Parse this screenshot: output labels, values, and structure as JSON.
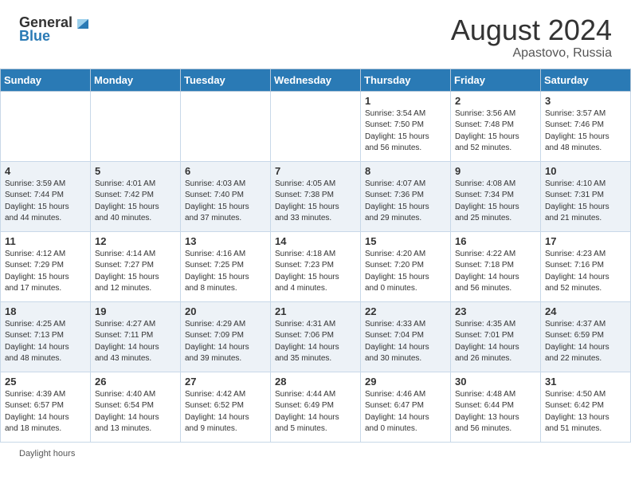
{
  "header": {
    "logo_general": "General",
    "logo_blue": "Blue",
    "month_year": "August 2024",
    "location": "Apastovo, Russia"
  },
  "footer": {
    "daylight_label": "Daylight hours"
  },
  "calendar": {
    "days_of_week": [
      "Sunday",
      "Monday",
      "Tuesday",
      "Wednesday",
      "Thursday",
      "Friday",
      "Saturday"
    ],
    "weeks": [
      [
        {
          "day": "",
          "info": ""
        },
        {
          "day": "",
          "info": ""
        },
        {
          "day": "",
          "info": ""
        },
        {
          "day": "",
          "info": ""
        },
        {
          "day": "1",
          "info": "Sunrise: 3:54 AM\nSunset: 7:50 PM\nDaylight: 15 hours\nand 56 minutes."
        },
        {
          "day": "2",
          "info": "Sunrise: 3:56 AM\nSunset: 7:48 PM\nDaylight: 15 hours\nand 52 minutes."
        },
        {
          "day": "3",
          "info": "Sunrise: 3:57 AM\nSunset: 7:46 PM\nDaylight: 15 hours\nand 48 minutes."
        }
      ],
      [
        {
          "day": "4",
          "info": "Sunrise: 3:59 AM\nSunset: 7:44 PM\nDaylight: 15 hours\nand 44 minutes."
        },
        {
          "day": "5",
          "info": "Sunrise: 4:01 AM\nSunset: 7:42 PM\nDaylight: 15 hours\nand 40 minutes."
        },
        {
          "day": "6",
          "info": "Sunrise: 4:03 AM\nSunset: 7:40 PM\nDaylight: 15 hours\nand 37 minutes."
        },
        {
          "day": "7",
          "info": "Sunrise: 4:05 AM\nSunset: 7:38 PM\nDaylight: 15 hours\nand 33 minutes."
        },
        {
          "day": "8",
          "info": "Sunrise: 4:07 AM\nSunset: 7:36 PM\nDaylight: 15 hours\nand 29 minutes."
        },
        {
          "day": "9",
          "info": "Sunrise: 4:08 AM\nSunset: 7:34 PM\nDaylight: 15 hours\nand 25 minutes."
        },
        {
          "day": "10",
          "info": "Sunrise: 4:10 AM\nSunset: 7:31 PM\nDaylight: 15 hours\nand 21 minutes."
        }
      ],
      [
        {
          "day": "11",
          "info": "Sunrise: 4:12 AM\nSunset: 7:29 PM\nDaylight: 15 hours\nand 17 minutes."
        },
        {
          "day": "12",
          "info": "Sunrise: 4:14 AM\nSunset: 7:27 PM\nDaylight: 15 hours\nand 12 minutes."
        },
        {
          "day": "13",
          "info": "Sunrise: 4:16 AM\nSunset: 7:25 PM\nDaylight: 15 hours\nand 8 minutes."
        },
        {
          "day": "14",
          "info": "Sunrise: 4:18 AM\nSunset: 7:23 PM\nDaylight: 15 hours\nand 4 minutes."
        },
        {
          "day": "15",
          "info": "Sunrise: 4:20 AM\nSunset: 7:20 PM\nDaylight: 15 hours\nand 0 minutes."
        },
        {
          "day": "16",
          "info": "Sunrise: 4:22 AM\nSunset: 7:18 PM\nDaylight: 14 hours\nand 56 minutes."
        },
        {
          "day": "17",
          "info": "Sunrise: 4:23 AM\nSunset: 7:16 PM\nDaylight: 14 hours\nand 52 minutes."
        }
      ],
      [
        {
          "day": "18",
          "info": "Sunrise: 4:25 AM\nSunset: 7:13 PM\nDaylight: 14 hours\nand 48 minutes."
        },
        {
          "day": "19",
          "info": "Sunrise: 4:27 AM\nSunset: 7:11 PM\nDaylight: 14 hours\nand 43 minutes."
        },
        {
          "day": "20",
          "info": "Sunrise: 4:29 AM\nSunset: 7:09 PM\nDaylight: 14 hours\nand 39 minutes."
        },
        {
          "day": "21",
          "info": "Sunrise: 4:31 AM\nSunset: 7:06 PM\nDaylight: 14 hours\nand 35 minutes."
        },
        {
          "day": "22",
          "info": "Sunrise: 4:33 AM\nSunset: 7:04 PM\nDaylight: 14 hours\nand 30 minutes."
        },
        {
          "day": "23",
          "info": "Sunrise: 4:35 AM\nSunset: 7:01 PM\nDaylight: 14 hours\nand 26 minutes."
        },
        {
          "day": "24",
          "info": "Sunrise: 4:37 AM\nSunset: 6:59 PM\nDaylight: 14 hours\nand 22 minutes."
        }
      ],
      [
        {
          "day": "25",
          "info": "Sunrise: 4:39 AM\nSunset: 6:57 PM\nDaylight: 14 hours\nand 18 minutes."
        },
        {
          "day": "26",
          "info": "Sunrise: 4:40 AM\nSunset: 6:54 PM\nDaylight: 14 hours\nand 13 minutes."
        },
        {
          "day": "27",
          "info": "Sunrise: 4:42 AM\nSunset: 6:52 PM\nDaylight: 14 hours\nand 9 minutes."
        },
        {
          "day": "28",
          "info": "Sunrise: 4:44 AM\nSunset: 6:49 PM\nDaylight: 14 hours\nand 5 minutes."
        },
        {
          "day": "29",
          "info": "Sunrise: 4:46 AM\nSunset: 6:47 PM\nDaylight: 14 hours\nand 0 minutes."
        },
        {
          "day": "30",
          "info": "Sunrise: 4:48 AM\nSunset: 6:44 PM\nDaylight: 13 hours\nand 56 minutes."
        },
        {
          "day": "31",
          "info": "Sunrise: 4:50 AM\nSunset: 6:42 PM\nDaylight: 13 hours\nand 51 minutes."
        }
      ]
    ]
  }
}
